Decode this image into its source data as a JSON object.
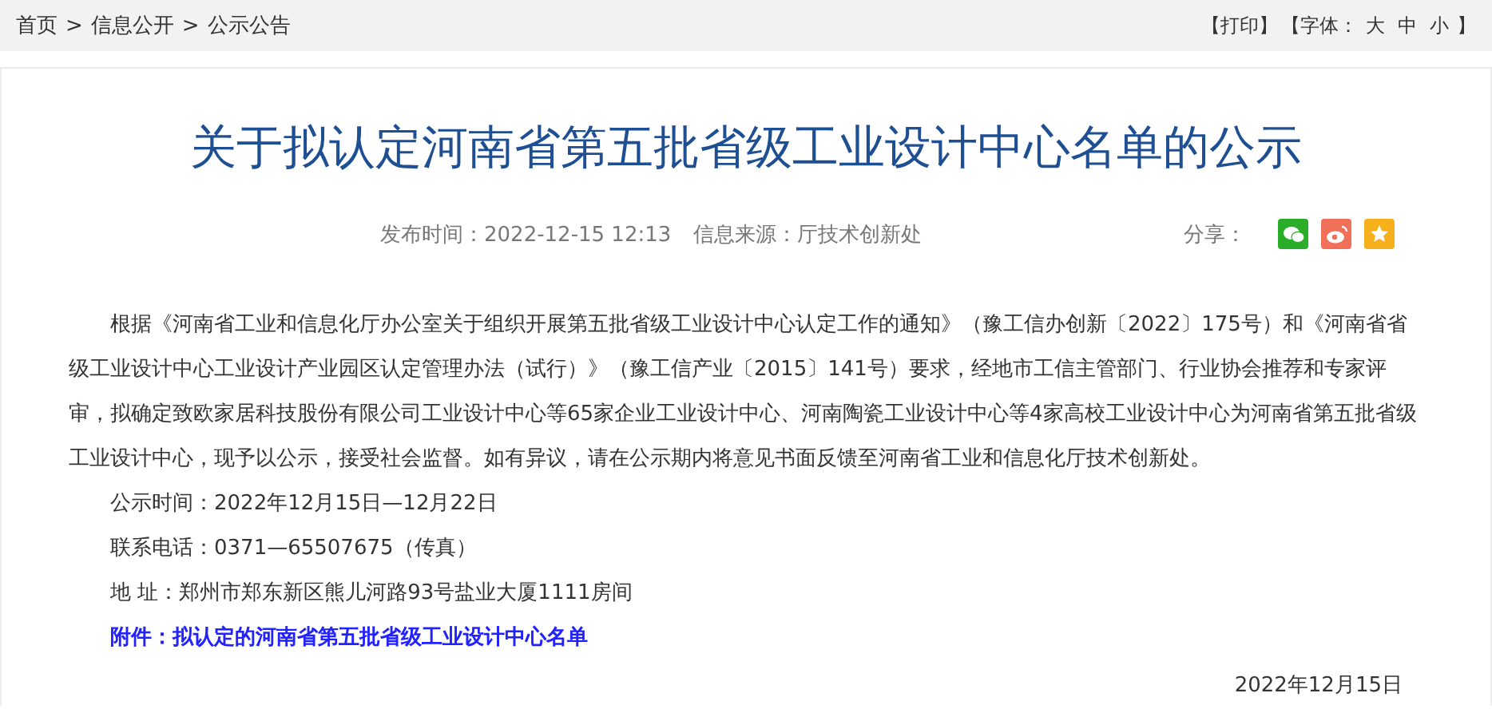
{
  "breadcrumb": [
    "首页",
    "信息公开",
    "公示公告"
  ],
  "breadcrumb_separator": ">",
  "tools": {
    "print": "【打印】",
    "font_label": "【字体：",
    "font_sizes": [
      "大",
      "中",
      "小"
    ],
    "font_end": "】"
  },
  "article": {
    "title": "关于拟认定河南省第五批省级工业设计中心名单的公示",
    "published": "发布时间：2022-12-15 12:13",
    "source": "信息来源：厅技术创新处",
    "share_label": "分享：",
    "share": [
      {
        "kind": "wechat",
        "color": "#2aae2a"
      },
      {
        "kind": "weibo",
        "color": "#f0705a"
      },
      {
        "kind": "favorite",
        "color": "#f5b01c"
      }
    ],
    "body": "根据《河南省工业和信息化厅办公室关于组织开展第五批省级工业设计中心认定工作的通知》（豫工信办创新〔2022〕175号）和《河南省省级工业设计中心工业设计产业园区认定管理办法（试行）》（豫工信产业〔2015〕141号）要求，经地市工信主管部门、行业协会推荐和专家评审，拟确定致欧家居科技股份有限公司工业设计中心等65家企业工业设计中心、河南陶瓷工业设计中心等4家高校工业设计中心为河南省第五批省级工业设计中心，现予以公示，接受社会监督。如有异议，请在公示期内将意见书面反馈至河南省工业和信息化厅技术创新处。",
    "details": [
      "公示时间：2022年12月15日—12月22日",
      "联系电话：0371—65507675（传真）",
      "地 址：郑州市郑东新区熊儿河路93号盐业大厦1111房间"
    ],
    "attachment": "附件：拟认定的河南省第五批省级工业设计中心名单",
    "date": "2022年12月15日"
  }
}
